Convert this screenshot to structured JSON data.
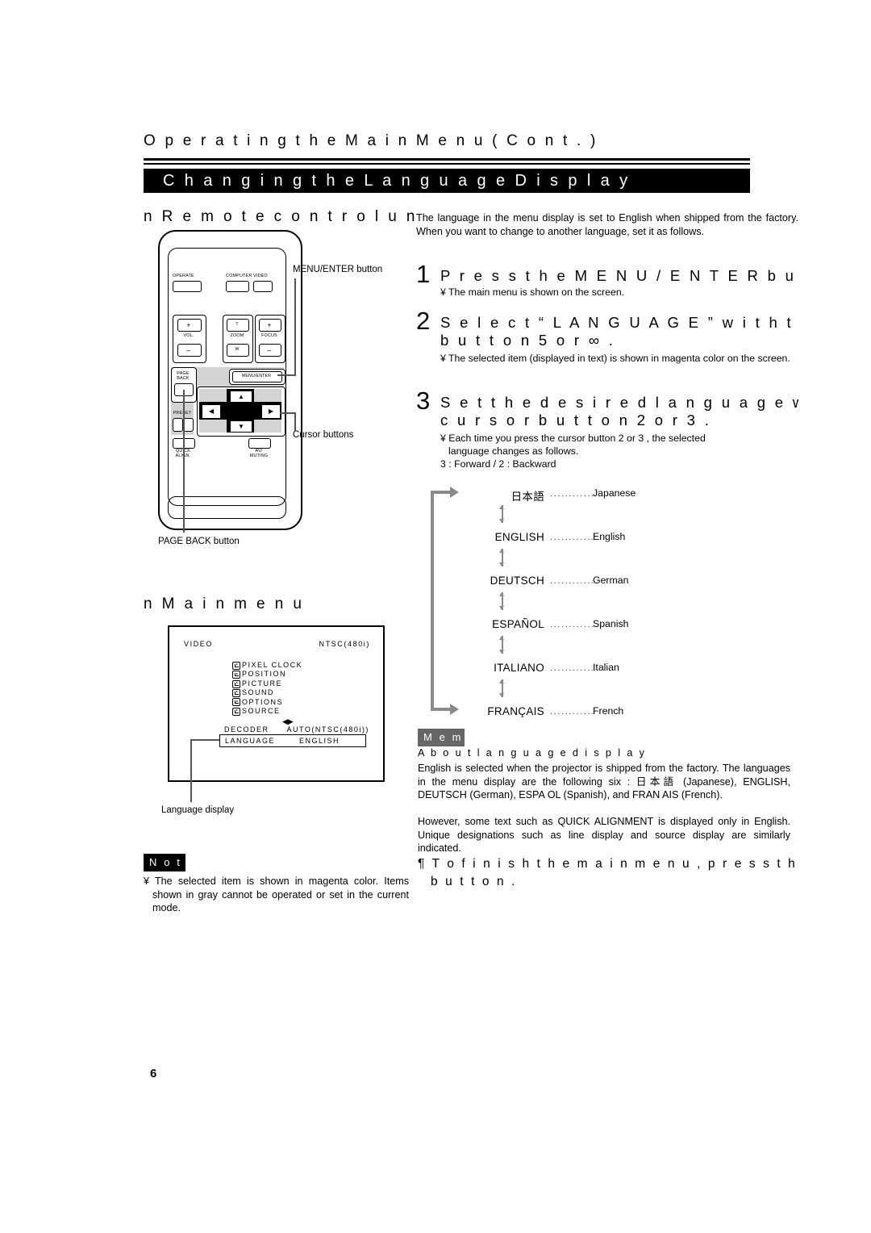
{
  "header": {
    "running_title": "O p e r a t i n g   t h e   M a i n   M e n u   ( C o n t . )",
    "band_title": "C h a n g i n g   t h e   L a n g u a g e   D i s p l a y"
  },
  "left": {
    "remote_heading": "n  R e m o t e   c o n t r o l   u n i t",
    "mainmenu_heading": "n  M a i n   m e n u",
    "remote": {
      "buttons": {
        "operate": "OPERATE",
        "computer": "COMPUTER",
        "video": "VIDEO",
        "vol": "VOL.",
        "vol_plus": "+",
        "vol_minus": "–",
        "zoom": "ZOOM",
        "zoom_t": "T",
        "zoom_w": "W",
        "focus": "FOCUS",
        "focus_plus": "+",
        "focus_minus": "–",
        "menu_enter": "MENU/ENTER",
        "page_back": "PAGE\nBACK",
        "preset": "PRESET",
        "quick_align": "QUICK\nALIGN.",
        "av_muting": "AV/\nMUTING"
      },
      "callouts": {
        "menu_enter": "MENU/ENTER\nbutton",
        "cursor": "Cursor buttons",
        "page_back": "PAGE BACK button"
      }
    },
    "osd": {
      "source": "VIDEO",
      "signal": "NTSC(480i)",
      "items": [
        "PIXEL CLOCK",
        "POSITION",
        "PICTURE",
        "SOUND",
        "OPTIONS",
        "SOURCE"
      ],
      "lr_marker": "◀▶",
      "decoder_label": "DECODER",
      "decoder_value": "AUTO(NTSC(480i))",
      "language_label": "LANGUAGE",
      "language_value": "ENGLISH",
      "caption": "Language display"
    },
    "note": {
      "badge": "N o t e",
      "text": "¥ The selected item is shown in magenta color. Items shown in gray cannot be operated or set in the current mode."
    }
  },
  "right": {
    "intro": "The language in the menu display is set to English when shipped from the factory. When you want to change to another language, set it as follows.",
    "steps": [
      {
        "num": "1",
        "head": "P r e s s   t h e   M E N U / E N T E R   b u t t o n .",
        "sub": "¥ The main menu is shown on the screen."
      },
      {
        "num": "2",
        "head_line1": "S e l e c t   “ L A N G U A G E ”   w i t h   t h e   c u r s o r",
        "head_line2": "b u t t o n  5  o r  ∞ .",
        "sub": "¥ The selected item (displayed in text) is shown in magenta color on the screen."
      },
      {
        "num": "3",
        "head_line1": "S e t   t h e   d e s i r e d   l a n g u a g e   w i t h   t h e",
        "head_line2": "c u r s o r   b u t t o n  2  o r  3 .",
        "sub_line1": "¥ Each time you press the cursor button 2  or 3 , the selected",
        "sub_line2": "language changes as follows.",
        "sub_line3": "3  : Forward  /  2  : Backward"
      }
    ],
    "language_flow": {
      "dots": "............",
      "items": [
        {
          "native": "日本語",
          "english": "Japanese"
        },
        {
          "native": "ENGLISH",
          "english": "English"
        },
        {
          "native": "DEUTSCH",
          "english": "German"
        },
        {
          "native": "ESPAÑOL",
          "english": "Spanish"
        },
        {
          "native": "ITALIANO",
          "english": "Italian"
        },
        {
          "native": "FRANÇAIS",
          "english": "French"
        }
      ]
    },
    "memo": {
      "badge": "M e m o",
      "subtitle": "A b o u t   l a n g u a g e   d i s p l a y",
      "para1": "English is selected when the projector is shipped from the factory. The languages in the menu display are the following six : 日本語 (Japanese), ENGLISH, DEUTSCH (German), ESPA OL (Spanish), and FRAN AIS (French).",
      "para2": "However, some text such as  QUICK ALIGNMENT  is displayed only in English. Unique designations such as line display and source display are similarly indicated."
    },
    "finish": {
      "line1": "¶ T o   f i n i s h   t h e   m a i n   m e n u ,   p r e s s   t h e   M E N U / E N T E R",
      "line2": "b u t t o n ."
    }
  },
  "page_number": "6"
}
